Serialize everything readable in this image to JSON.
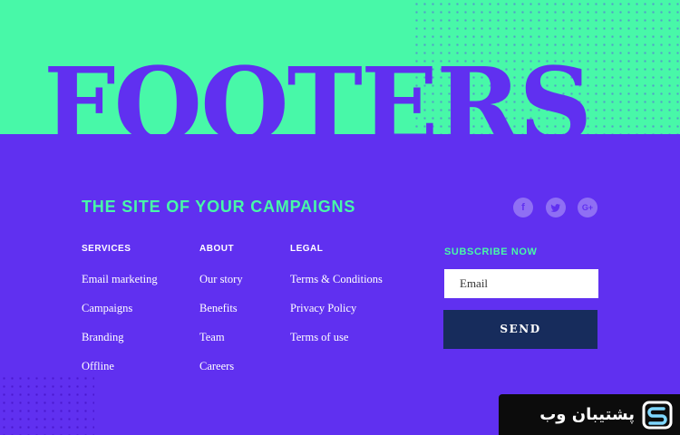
{
  "hero": {
    "title": "FOOTERS"
  },
  "tagline": "THE SITE OF YOUR CAMPAIGNS",
  "social": [
    {
      "icon": "facebook-icon",
      "glyph": "f"
    },
    {
      "icon": "twitter-icon",
      "glyph": "🐦"
    },
    {
      "icon": "google-plus-icon",
      "glyph": "G+"
    }
  ],
  "columns": {
    "services": {
      "heading": "SERVICES",
      "links": [
        "Email marketing",
        "Campaigns",
        "Branding",
        "Offline"
      ]
    },
    "about": {
      "heading": "ABOUT",
      "links": [
        "Our story",
        "Benefits",
        "Team",
        "Careers"
      ]
    },
    "legal": {
      "heading": "LEGAL",
      "links": [
        "Terms & Conditions",
        "Privacy Policy",
        "Terms of use"
      ]
    }
  },
  "subscribe": {
    "label": "SUBSCRIBE NOW",
    "placeholder": "Email",
    "button": "SEND"
  },
  "watermark": {
    "text": "پشتیبان وب"
  },
  "colors": {
    "mint": "#48f8a8",
    "purple": "#6030f0",
    "navy": "#172c5c"
  }
}
